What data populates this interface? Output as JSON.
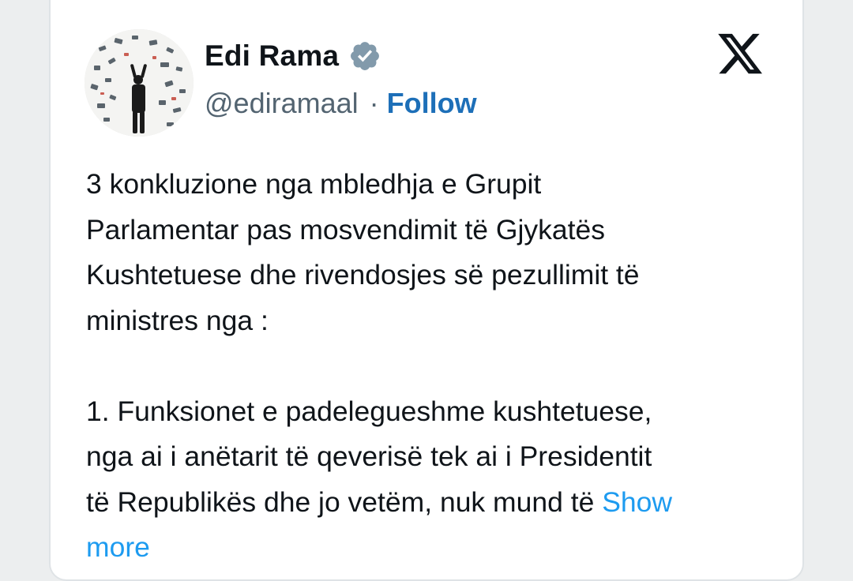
{
  "author": {
    "name": "Edi Rama",
    "handle": "@ediramaal",
    "separator": "·",
    "follow_label": "Follow",
    "verified_icon": "verified-badge-icon",
    "avatar": "profile-photo"
  },
  "platform_logo": "x-logo-icon",
  "tweet": {
    "paragraph_1": "3 konkluzione nga mbledhja e Grupit\nParlamentar pas mosvendimit të Gjykatës\nKushtetuese dhe rivendosjes së pezullimit të\nministres nga :",
    "paragraph_2": "1. Funksionet e padelegueshme kushtetuese,\nnga ai i anëtarit të qeverisë tek ai i Presidentit\ntë Republikës dhe jo vetëm, nuk mund të ",
    "show_more_label": "Show\nmore"
  },
  "colors": {
    "text": "#0f1419",
    "secondary": "#536471",
    "follow": "#1d6fb8",
    "show_more": "#1d9bf0",
    "verified": "#829aab"
  }
}
